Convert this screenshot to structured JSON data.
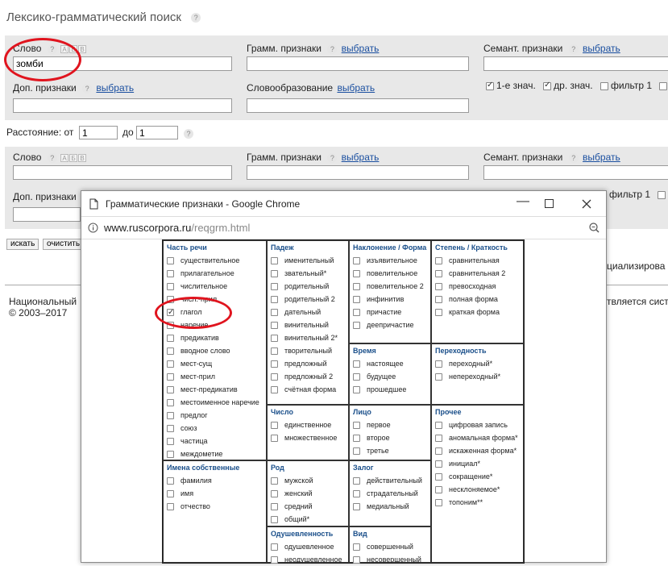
{
  "page": {
    "title": "Лексико-грамматический поиск",
    "help": "?",
    "select_link": "выбрать",
    "fields": {
      "word": "Слово",
      "gramm": "Грамм. признаки",
      "semant": "Семант. признаки",
      "dop": "Доп. признаки",
      "slovoobr": "Словообразование"
    },
    "kbd_keys": [
      "А",
      "Б",
      "В"
    ],
    "word_value": "зомби",
    "options": {
      "first_meaning": "1-е знач.",
      "other_meaning": "др. знач.",
      "filter": "фильтр 1"
    },
    "distance": {
      "label": "Расстояние: от",
      "to": "до",
      "from_value": "1",
      "to_value": "1"
    },
    "buttons": {
      "search": "искать",
      "clear": "очистить"
    },
    "footer_left_1": "Национальный",
    "footer_left_2": "© 2003–2017",
    "footer_right_1": "циализирова",
    "footer_right_2": "твляется сист"
  },
  "popup": {
    "window_title": "Грамматические признаки - Google Chrome",
    "url_host": "www.ruscorpora.ru",
    "url_path": "/reqgrm.html",
    "sections": {
      "pos": {
        "title": "Часть речи",
        "items": [
          "существительное",
          "прилагательное",
          "числительное",
          "числ.-прил.",
          "глагол",
          "наречие",
          "предикатив",
          "вводное слово",
          "мест-сущ",
          "мест-прил",
          "мест-предикатив",
          "местоименное наречие",
          "предлог",
          "союз",
          "частица",
          "междометие"
        ]
      },
      "case": {
        "title": "Падеж",
        "items": [
          "именительный",
          "звательный*",
          "родительный",
          "родительный 2",
          "дательный",
          "винительный",
          "винительный 2*",
          "творительный",
          "предложный",
          "предложный 2",
          "счётная форма"
        ]
      },
      "mood": {
        "title": "Наклонение / Форма",
        "items": [
          "изъявительное",
          "повелительное",
          "повелительное 2",
          "инфинитив",
          "причастие",
          "деепричастие"
        ]
      },
      "degree": {
        "title": "Степень / Краткость",
        "items": [
          "сравнительная",
          "сравнительная 2",
          "превосходная",
          "полная форма",
          "краткая форма"
        ]
      },
      "tense": {
        "title": "Время",
        "items": [
          "настоящее",
          "будущее",
          "прошедшее"
        ]
      },
      "trans": {
        "title": "Переходность",
        "items": [
          "переходный*",
          "непереходный*"
        ]
      },
      "number": {
        "title": "Число",
        "items": [
          "единственное",
          "множественное"
        ]
      },
      "person": {
        "title": "Лицо",
        "items": [
          "первое",
          "второе",
          "третье"
        ]
      },
      "other": {
        "title": "Прочее",
        "items": [
          "цифровая запись",
          "аномальная форма*",
          "искаженная форма*",
          "инициал*",
          "сокращение*",
          "несклоняемое*",
          "топоним**"
        ]
      },
      "proper": {
        "title": "Имена собственные",
        "items": [
          "фамилия",
          "имя",
          "отчество"
        ]
      },
      "gender": {
        "title": "Род",
        "items": [
          "мужской",
          "женский",
          "средний",
          "общий*"
        ]
      },
      "voice": {
        "title": "Залог",
        "items": [
          "действительный",
          "страдательный",
          "медиальный"
        ]
      },
      "anim": {
        "title": "Одушевленность",
        "items": [
          "одушевленное",
          "неодушевленное"
        ]
      },
      "aspect": {
        "title": "Вид",
        "items": [
          "совершенный",
          "несовершенный"
        ]
      }
    },
    "checked_item": "глагол"
  },
  "colors": {
    "panel": "#e8e8e8",
    "link": "#1a4fa0",
    "highlight_circle": "#e0141e",
    "section_head": "#1a4f8a"
  }
}
